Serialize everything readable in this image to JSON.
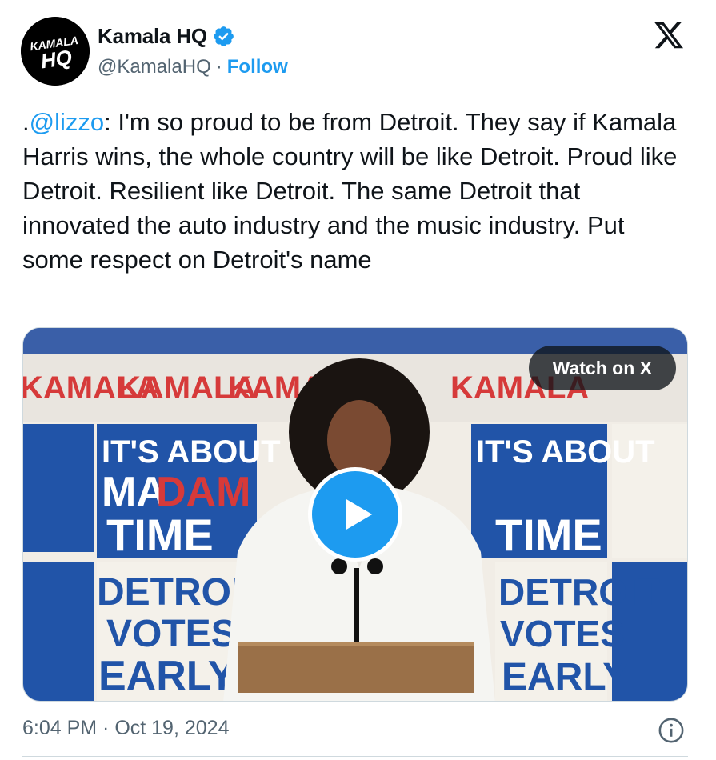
{
  "tweet": {
    "author": {
      "display_name": "Kamala HQ",
      "handle": "@KamalaHQ",
      "separator": "·",
      "follow_label": "Follow",
      "avatar_text_top": "KAMALA",
      "avatar_text_bottom": "HQ",
      "verified": true
    },
    "text_prefix": ".",
    "mention": "@lizzo",
    "text_body": ": I'm so proud to be from Detroit. They say if Kamala Harris wins, the whole country will be like Detroit. Proud like Detroit. Resilient like Detroit. The same Detroit that innovated the auto industry and the music industry. Put some respect on Detroit's name",
    "media": {
      "watch_label": "Watch on X",
      "banner_word": "KAMALA",
      "sign_1": "IT'S ABOUT",
      "sign_2_a": "MA",
      "sign_2_b": "DAM",
      "sign_3": "TIME",
      "sign_4": "DETROIT",
      "sign_5": "VOTES",
      "sign_6": "EARLY"
    },
    "timestamp": "6:04 PM · Oct 19, 2024"
  },
  "colors": {
    "link": "#1d9bf0",
    "secondary_text": "#536471",
    "primary_text": "#0f1419",
    "sign_blue": "#2154a8",
    "sign_red": "#d63a3a"
  },
  "icons": {
    "verified": "verified-badge-icon",
    "platform": "x-logo-icon",
    "play": "play-icon",
    "info": "info-icon"
  }
}
